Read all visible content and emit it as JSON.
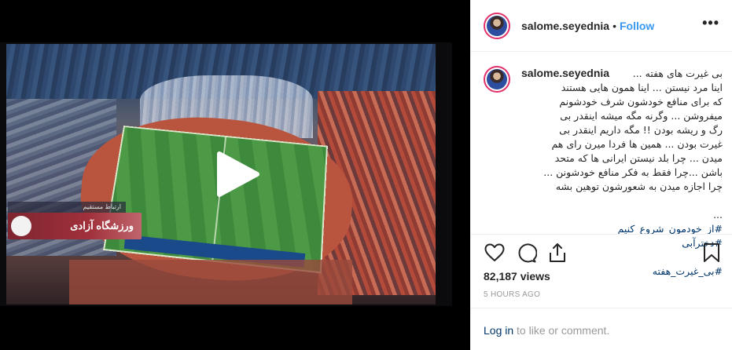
{
  "video": {
    "tv_banner_small": "ارتباط مستقیم",
    "tv_banner_text": "ورزشگاه آزادی"
  },
  "header": {
    "username": "salome.seyednia",
    "separator": "•",
    "follow_label": "Follow",
    "more_label": "•••"
  },
  "caption": {
    "username": "salome.seyednia",
    "first_line": "بی غیرت های هفته ...",
    "text": "اینا مرد نیستن ... اینا همون هایی هستند\nکه برای منافع خودشون شرف خودشونم\nمیفروشن ... وگرنه مگه میشه اینقدر بی\nرگ و ریشه بودن !! مگه داریم اینقدر بی\nغیرت بودن ... همین ها فردا میرن رای هم\nمیدن ... چرا بلد نیستن ایرانی ها که متحد\nباشن ...چرا فقط به فکر منافع خودشونن ...\nچرا اجازه میدن به شعورشون توهین بشه",
    "hashtag_line_prefix": "...",
    "hashtag_1": "#از_خودمون_شروع_کنیم",
    "hashtag_2": "#دخترآبی",
    "hashtag_3": "#بی_غیرت_هفته"
  },
  "stats": {
    "views": "82,187 views",
    "time": "5 HOURS AGO"
  },
  "footer": {
    "login_link": "Log in",
    "login_rest": " to like or comment."
  },
  "icons": {
    "like": "heart-icon",
    "comment": "comment-icon",
    "share": "share-icon",
    "save": "bookmark-icon",
    "play": "play-icon"
  },
  "colors": {
    "follow": "#3897f0",
    "link": "#003569",
    "muted": "#999999",
    "avatar_ring": "#e1306c"
  }
}
